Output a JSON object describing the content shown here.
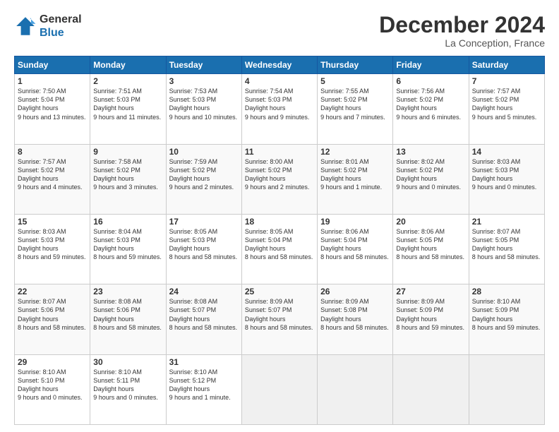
{
  "header": {
    "logo_line1": "General",
    "logo_line2": "Blue",
    "month": "December 2024",
    "location": "La Conception, France"
  },
  "weekdays": [
    "Sunday",
    "Monday",
    "Tuesday",
    "Wednesday",
    "Thursday",
    "Friday",
    "Saturday"
  ],
  "weeks": [
    [
      {
        "day": 1,
        "sunrise": "7:50 AM",
        "sunset": "5:04 PM",
        "daylight": "9 hours and 13 minutes."
      },
      {
        "day": 2,
        "sunrise": "7:51 AM",
        "sunset": "5:03 PM",
        "daylight": "9 hours and 11 minutes."
      },
      {
        "day": 3,
        "sunrise": "7:53 AM",
        "sunset": "5:03 PM",
        "daylight": "9 hours and 10 minutes."
      },
      {
        "day": 4,
        "sunrise": "7:54 AM",
        "sunset": "5:03 PM",
        "daylight": "9 hours and 9 minutes."
      },
      {
        "day": 5,
        "sunrise": "7:55 AM",
        "sunset": "5:02 PM",
        "daylight": "9 hours and 7 minutes."
      },
      {
        "day": 6,
        "sunrise": "7:56 AM",
        "sunset": "5:02 PM",
        "daylight": "9 hours and 6 minutes."
      },
      {
        "day": 7,
        "sunrise": "7:57 AM",
        "sunset": "5:02 PM",
        "daylight": "9 hours and 5 minutes."
      }
    ],
    [
      {
        "day": 8,
        "sunrise": "7:57 AM",
        "sunset": "5:02 PM",
        "daylight": "9 hours and 4 minutes."
      },
      {
        "day": 9,
        "sunrise": "7:58 AM",
        "sunset": "5:02 PM",
        "daylight": "9 hours and 3 minutes."
      },
      {
        "day": 10,
        "sunrise": "7:59 AM",
        "sunset": "5:02 PM",
        "daylight": "9 hours and 2 minutes."
      },
      {
        "day": 11,
        "sunrise": "8:00 AM",
        "sunset": "5:02 PM",
        "daylight": "9 hours and 2 minutes."
      },
      {
        "day": 12,
        "sunrise": "8:01 AM",
        "sunset": "5:02 PM",
        "daylight": "9 hours and 1 minute."
      },
      {
        "day": 13,
        "sunrise": "8:02 AM",
        "sunset": "5:02 PM",
        "daylight": "9 hours and 0 minutes."
      },
      {
        "day": 14,
        "sunrise": "8:03 AM",
        "sunset": "5:03 PM",
        "daylight": "9 hours and 0 minutes."
      }
    ],
    [
      {
        "day": 15,
        "sunrise": "8:03 AM",
        "sunset": "5:03 PM",
        "daylight": "8 hours and 59 minutes."
      },
      {
        "day": 16,
        "sunrise": "8:04 AM",
        "sunset": "5:03 PM",
        "daylight": "8 hours and 59 minutes."
      },
      {
        "day": 17,
        "sunrise": "8:05 AM",
        "sunset": "5:03 PM",
        "daylight": "8 hours and 58 minutes."
      },
      {
        "day": 18,
        "sunrise": "8:05 AM",
        "sunset": "5:04 PM",
        "daylight": "8 hours and 58 minutes."
      },
      {
        "day": 19,
        "sunrise": "8:06 AM",
        "sunset": "5:04 PM",
        "daylight": "8 hours and 58 minutes."
      },
      {
        "day": 20,
        "sunrise": "8:06 AM",
        "sunset": "5:05 PM",
        "daylight": "8 hours and 58 minutes."
      },
      {
        "day": 21,
        "sunrise": "8:07 AM",
        "sunset": "5:05 PM",
        "daylight": "8 hours and 58 minutes."
      }
    ],
    [
      {
        "day": 22,
        "sunrise": "8:07 AM",
        "sunset": "5:06 PM",
        "daylight": "8 hours and 58 minutes."
      },
      {
        "day": 23,
        "sunrise": "8:08 AM",
        "sunset": "5:06 PM",
        "daylight": "8 hours and 58 minutes."
      },
      {
        "day": 24,
        "sunrise": "8:08 AM",
        "sunset": "5:07 PM",
        "daylight": "8 hours and 58 minutes."
      },
      {
        "day": 25,
        "sunrise": "8:09 AM",
        "sunset": "5:07 PM",
        "daylight": "8 hours and 58 minutes."
      },
      {
        "day": 26,
        "sunrise": "8:09 AM",
        "sunset": "5:08 PM",
        "daylight": "8 hours and 58 minutes."
      },
      {
        "day": 27,
        "sunrise": "8:09 AM",
        "sunset": "5:09 PM",
        "daylight": "8 hours and 59 minutes."
      },
      {
        "day": 28,
        "sunrise": "8:10 AM",
        "sunset": "5:09 PM",
        "daylight": "8 hours and 59 minutes."
      }
    ],
    [
      {
        "day": 29,
        "sunrise": "8:10 AM",
        "sunset": "5:10 PM",
        "daylight": "9 hours and 0 minutes."
      },
      {
        "day": 30,
        "sunrise": "8:10 AM",
        "sunset": "5:11 PM",
        "daylight": "9 hours and 0 minutes."
      },
      {
        "day": 31,
        "sunrise": "8:10 AM",
        "sunset": "5:12 PM",
        "daylight": "9 hours and 1 minute."
      },
      null,
      null,
      null,
      null
    ]
  ]
}
